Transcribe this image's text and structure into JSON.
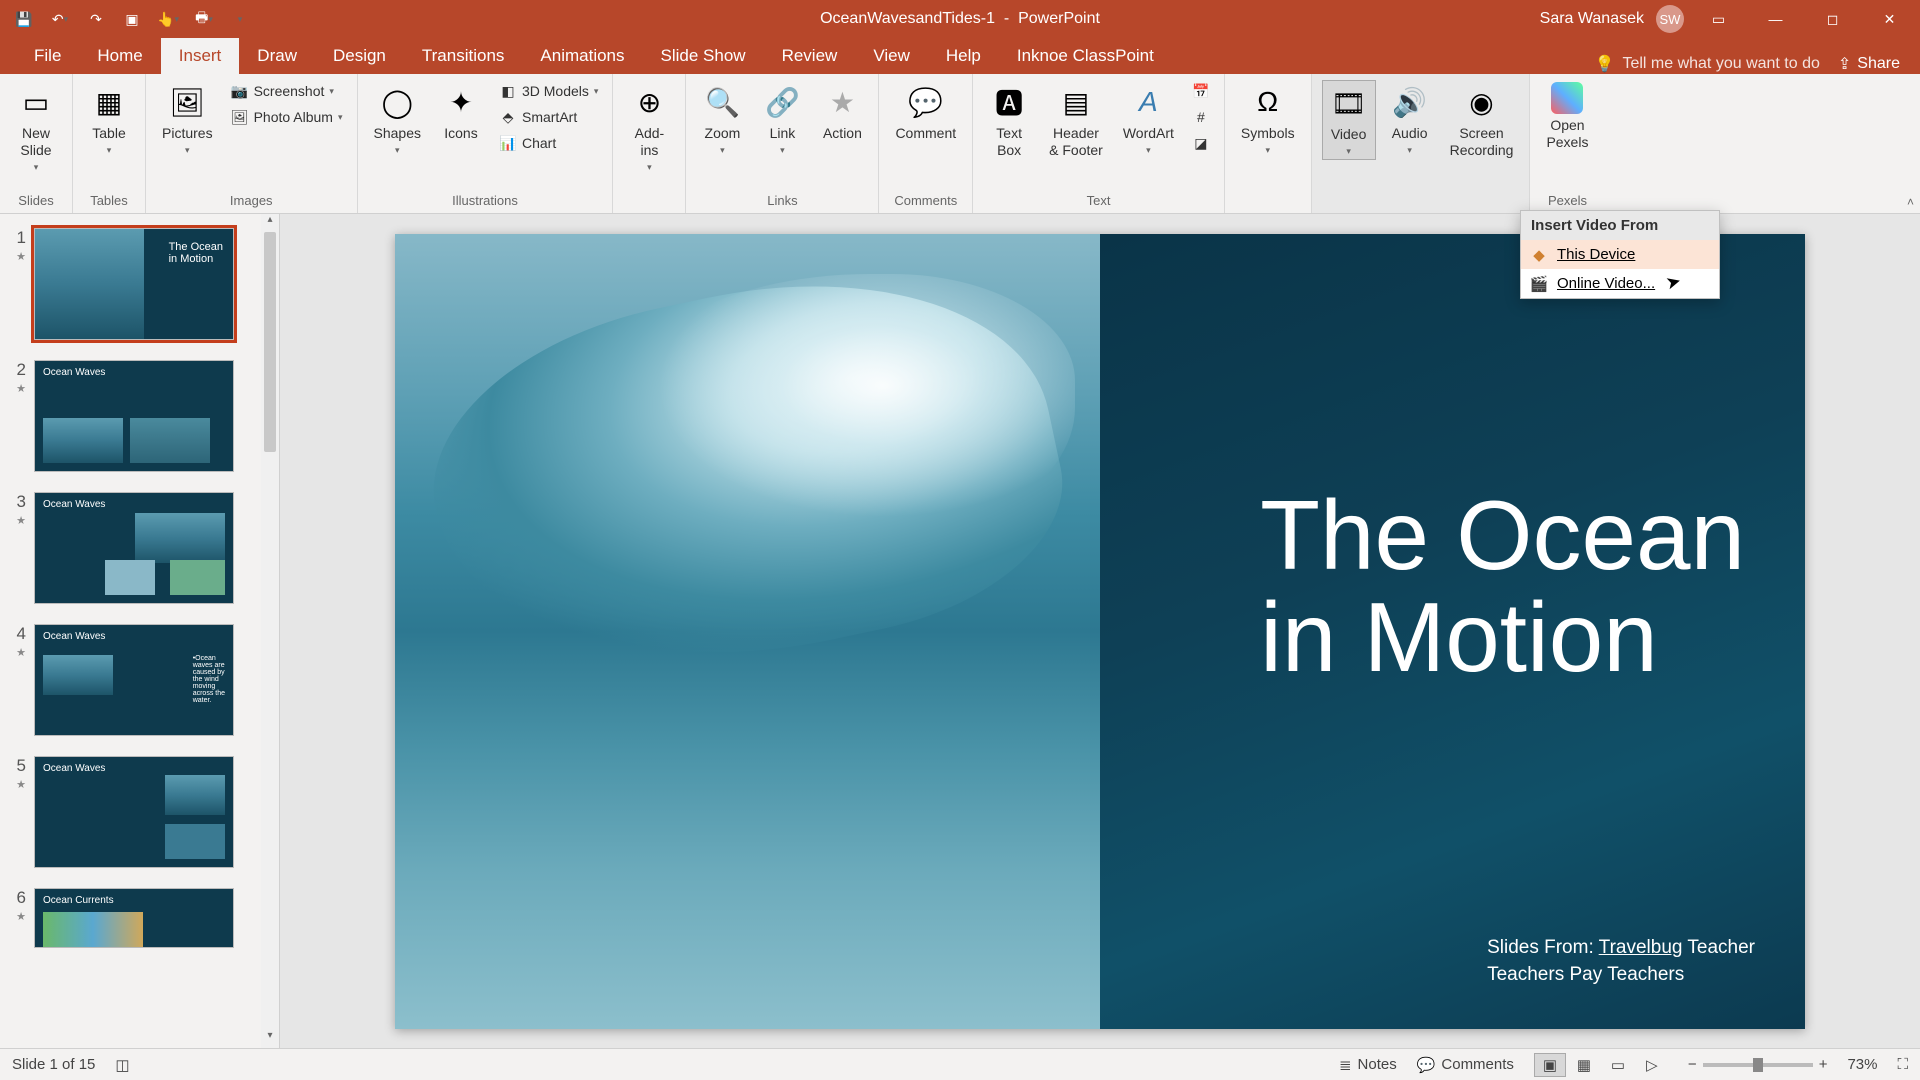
{
  "titlebar": {
    "doc_name": "OceanWavesandTides-1",
    "app_name": "PowerPoint",
    "user_name": "Sara Wanasek",
    "user_initials": "SW"
  },
  "tabs": {
    "file": "File",
    "home": "Home",
    "insert": "Insert",
    "draw": "Draw",
    "design": "Design",
    "transitions": "Transitions",
    "animations": "Animations",
    "slideshow": "Slide Show",
    "review": "Review",
    "view": "View",
    "help": "Help",
    "classpoint": "Inknoe ClassPoint",
    "tellme": "Tell me what you want to do",
    "share": "Share"
  },
  "ribbon": {
    "slides": {
      "new_slide": "New\nSlide",
      "group": "Slides"
    },
    "tables": {
      "table": "Table",
      "group": "Tables"
    },
    "images": {
      "pictures": "Pictures",
      "screenshot": "Screenshot",
      "photo_album": "Photo Album",
      "group": "Images"
    },
    "illustrations": {
      "shapes": "Shapes",
      "icons": "Icons",
      "models": "3D Models",
      "smartart": "SmartArt",
      "chart": "Chart",
      "group": "Illustrations"
    },
    "addins": {
      "addins": "Add-\nins"
    },
    "links": {
      "zoom": "Zoom",
      "link": "Link",
      "action": "Action",
      "group": "Links"
    },
    "comments": {
      "comment": "Comment",
      "group": "Comments"
    },
    "text": {
      "textbox": "Text\nBox",
      "header": "Header\n& Footer",
      "wordart": "WordArt",
      "group": "Text"
    },
    "symbols": {
      "symbols": "Symbols"
    },
    "media": {
      "video": "Video",
      "audio": "Audio",
      "screenrec": "Screen\nRecording"
    },
    "pexels": {
      "open": "Open\nPexels",
      "group": "Pexels"
    }
  },
  "dropdown": {
    "header": "Insert Video From",
    "this_device": "This Device",
    "online_video": "Online Video..."
  },
  "slide": {
    "title_line1": "The Ocean",
    "title_line2": "in Motion",
    "credits_line1_a": "Slides From: ",
    "credits_line1_b": "Travelbug",
    "credits_line1_c": " Teacher",
    "credits_line2": "Teachers Pay Teachers"
  },
  "thumbs": {
    "t1": "The Ocean\nin Motion",
    "t2_title": "Ocean Waves",
    "t3_title": "Ocean Waves",
    "t4_title": "Ocean Waves",
    "t4_text": "•Ocean\nwaves are\ncaused by\nthe wind\nmoving\nacross the\nwater.",
    "t5_title": "Ocean Waves",
    "t6_title": "Ocean Currents"
  },
  "status": {
    "slide_info": "Slide 1 of 15",
    "notes": "Notes",
    "comments": "Comments",
    "zoom_pct": "73%"
  }
}
